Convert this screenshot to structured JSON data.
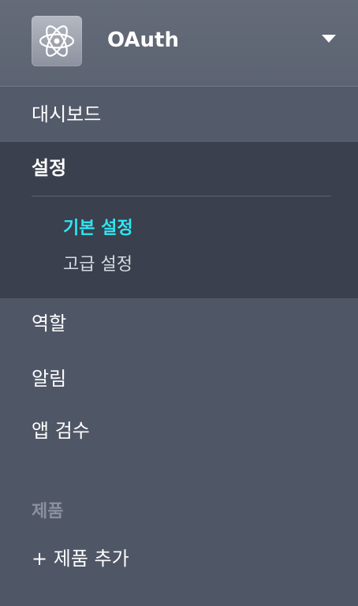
{
  "app": {
    "name": "OAuth",
    "icon": "atom-icon"
  },
  "nav": {
    "dashboard": "대시보드",
    "settings": "설정",
    "settings_items": [
      "기본 설정",
      "고급 설정"
    ],
    "roles": "역할",
    "alerts": "알림",
    "app_review": "앱 검수"
  },
  "products": {
    "section_label": "제품",
    "add_label": "+ 제품 추가"
  },
  "colors": {
    "active_link": "#2ee7f2",
    "sidebar_bg": "#4f5666",
    "settings_bg": "#3a404d"
  }
}
